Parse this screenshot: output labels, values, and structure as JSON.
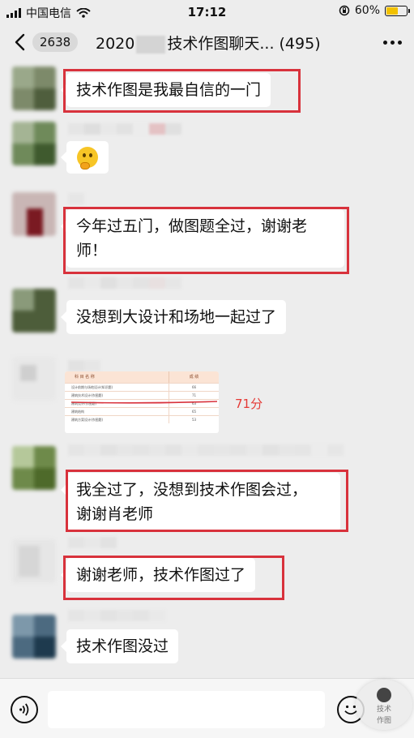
{
  "status_bar": {
    "carrier": "中国电信",
    "time": "17:12",
    "battery_percent_label": "60%",
    "battery_level": 0.6,
    "icons": [
      "signal-icon",
      "wifi-icon",
      "lock-rotation-icon",
      "battery-icon"
    ]
  },
  "nav": {
    "unread_count": "2638",
    "title_prefix": "2020",
    "title_suffix": "技术作图聊天... (495)",
    "icons": [
      "back-arrow-icon",
      "more-dots-icon"
    ]
  },
  "messages": [
    {
      "type": "text",
      "lines": [
        "技术作图是我最自信的一门"
      ],
      "highlighted": true
    },
    {
      "type": "emoji",
      "emoji_name": "thinking-face-emoji"
    },
    {
      "type": "text",
      "lines": [
        "今年过五门，做图题全过，谢谢老",
        "师！"
      ],
      "highlighted": true
    },
    {
      "type": "text",
      "lines": [
        "没想到大设计和场地一起过了"
      ],
      "highlighted": false
    },
    {
      "type": "image",
      "caption": "71分"
    },
    {
      "type": "text",
      "lines": [
        "我全过了，没想到技术作图会过，",
        "谢谢肖老师"
      ],
      "highlighted": true
    },
    {
      "type": "text",
      "lines": [
        "谢谢老师，技术作图过了"
      ],
      "highlighted": true
    },
    {
      "type": "text",
      "lines": [
        "技术作图没过"
      ],
      "highlighted": false
    }
  ],
  "score_table": {
    "header": [
      "科 目 名 称",
      "成 绩"
    ],
    "rows": [
      [
        "设计前期与场地设计(知识题)",
        "66"
      ],
      [
        "建筑技术设计(作图题)",
        "71"
      ],
      [
        "建筑设计(作图题)",
        "63"
      ],
      [
        "建筑结构",
        "65"
      ],
      [
        "建筑方案设计(作图题)",
        "53"
      ]
    ]
  },
  "input_bar": {
    "placeholder": "",
    "icons": [
      "voice-input-icon",
      "emoji-icon"
    ],
    "watermark_text": [
      "技术",
      "作图"
    ]
  },
  "colors": {
    "background": "#ededed",
    "bubble": "#ffffff",
    "highlight_border": "#d8323c",
    "score_note": "#e53935",
    "battery_fill": "#f2c100"
  }
}
